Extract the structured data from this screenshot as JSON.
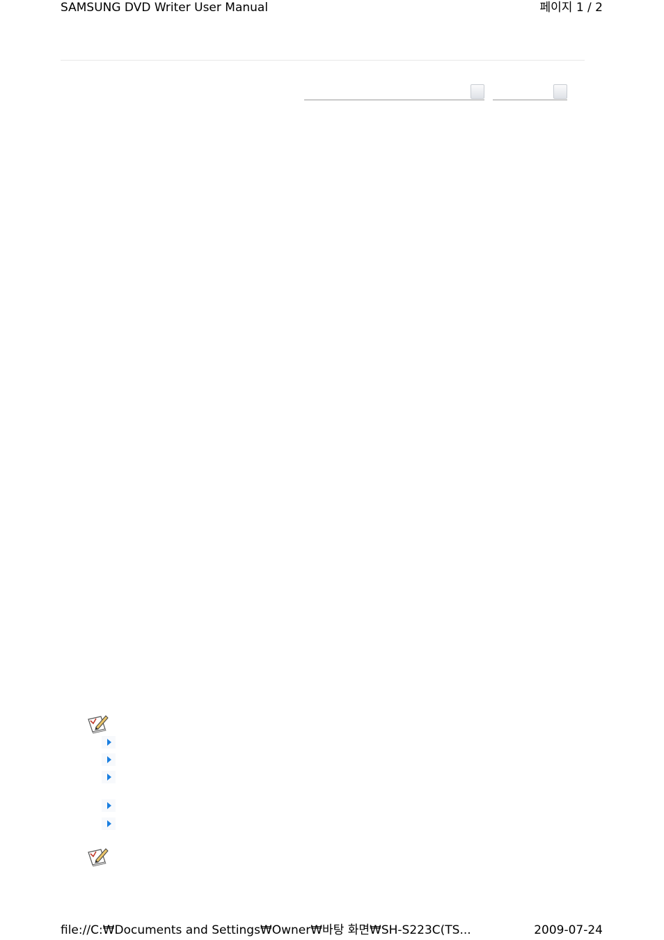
{
  "header": {
    "title": "SAMSUNG DVD Writer User Manual",
    "page_indicator": "페이지 1 / 2"
  },
  "controls": {
    "select_primary": {
      "value": "",
      "icon": "dropdown-button"
    },
    "select_secondary": {
      "value": "",
      "icon": "dropdown-button"
    }
  },
  "notes": [
    {
      "icon": "note-pencil-icon",
      "bullets": [
        "",
        "",
        "",
        "",
        ""
      ]
    },
    {
      "icon": "note-pencil-icon"
    }
  ],
  "colors": {
    "bullet_arrow": "#1a7fe0",
    "divider": "#e8e8e8"
  },
  "footer": {
    "path": "file://C:₩Documents and Settings₩Owner₩바탕 화면₩SH-S223C(TS...",
    "date": "2009-07-24"
  }
}
